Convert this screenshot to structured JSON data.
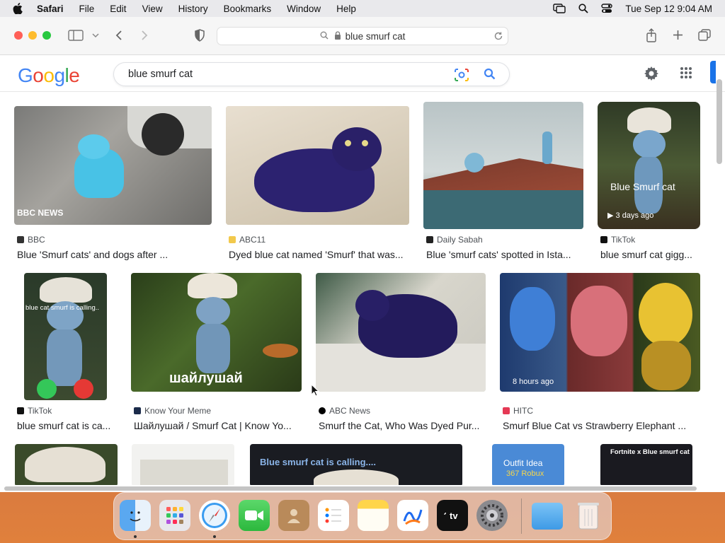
{
  "menubar": {
    "app": "Safari",
    "items": [
      "File",
      "Edit",
      "View",
      "History",
      "Bookmarks",
      "Window",
      "Help"
    ],
    "clock": "Tue Sep 12  9:04 AM"
  },
  "browser": {
    "url": "blue smurf cat"
  },
  "google": {
    "logo": "Google",
    "query": "blue smurf cat"
  },
  "results": [
    {
      "source": "BBC",
      "title": "Blue 'Smurf cats' and dogs after ...",
      "overlay": "BBC NEWS"
    },
    {
      "source": "ABC11",
      "title": "Dyed blue cat named 'Smurf' that was...",
      "overlay": ""
    },
    {
      "source": "Daily Sabah",
      "title": "Blue 'smurf cats' spotted in Ista...",
      "overlay": ""
    },
    {
      "source": "TikTok",
      "title": "blue smurf cat gigg...",
      "overlay": "Blue Smurf cat",
      "badge": "3 days ago"
    },
    {
      "source": "TikTok",
      "title": "blue smurf cat is ca...",
      "overlay": "blue cat smurf is calling.."
    },
    {
      "source": "Know Your Meme",
      "title": "Шайлушай / Smurf Cat | Know Yo...",
      "overlay": "шайлушай"
    },
    {
      "source": "ABC News",
      "title": "Smurf the Cat, Who Was Dyed Pur...",
      "overlay": ""
    },
    {
      "source": "HITC",
      "title": "Smurf Blue Cat vs Strawberry Elephant ...",
      "badge": "8 hours ago"
    }
  ],
  "row3": {
    "banner": "Blue smurf cat is calling....",
    "outfit": "Outfit Idea",
    "robux": "367 Robux",
    "fortnite": "Fortnite x Blue smurf cat"
  },
  "colors": {
    "accent": "#1a73e8",
    "red_light": "#ff5f57",
    "yellow_light": "#febc2e",
    "green_light": "#28c840"
  }
}
